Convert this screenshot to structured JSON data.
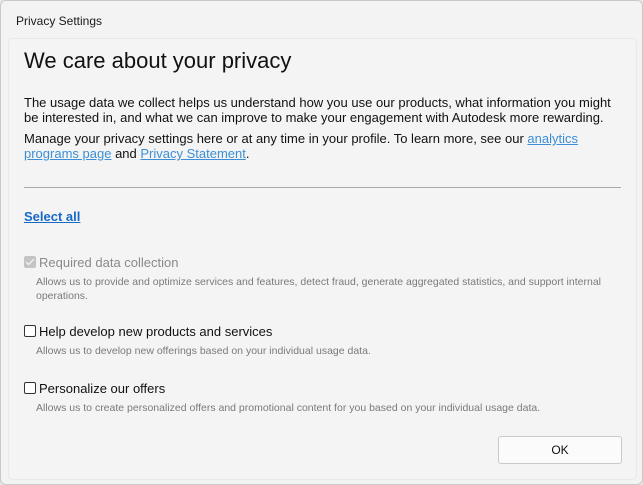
{
  "window": {
    "title": "Privacy Settings"
  },
  "content": {
    "heading": "We care about your privacy",
    "para1": "The usage data we collect helps us understand how you use our products, what information you might be interested in, and what we can improve to make your engagement with Autodesk more rewarding.",
    "para2_prefix": "Manage your privacy settings here or at any time in your profile. To learn more, see our ",
    "analytics_link": "analytics programs page",
    "para2_and": " and ",
    "privacy_link": "Privacy Statement",
    "para2_suffix": ".",
    "select_all": "Select all"
  },
  "options": [
    {
      "label": "Required data collection",
      "description": "Allows us to provide and optimize services and features, detect fraud, generate aggregated statistics, and support internal operations.",
      "checked": true,
      "disabled": true
    },
    {
      "label": "Help develop new products and services",
      "description": "Allows us to develop new offerings based on your individual usage data.",
      "checked": false,
      "disabled": false
    },
    {
      "label": "Personalize our offers",
      "description": "Allows us to create personalized offers and promotional content for you based on your individual usage data.",
      "checked": false,
      "disabled": false
    }
  ],
  "footer": {
    "ok_label": "OK"
  }
}
